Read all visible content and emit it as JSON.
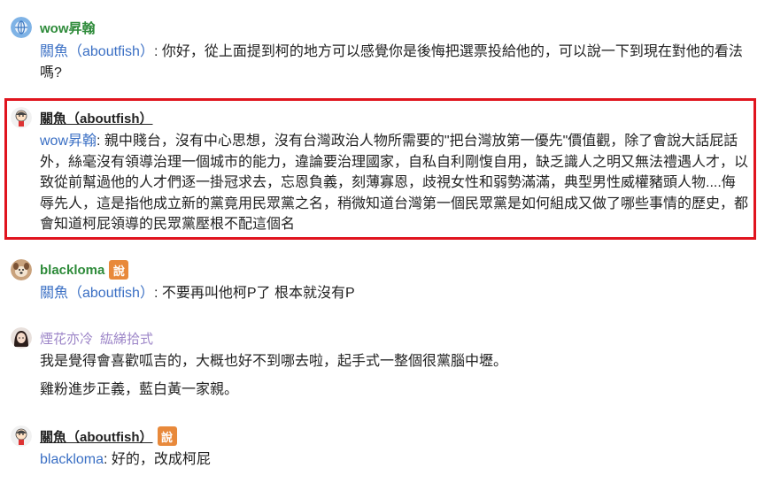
{
  "comments": [
    {
      "author": "wow昇翰",
      "reply_to": "關魚（aboutfish）",
      "sep": ": ",
      "text": "你好，從上面提到柯的地方可以感覺你是後悔把選票投給他的，可以說一下到現在對他的看法嗎?"
    },
    {
      "author": "關魚（aboutfish）",
      "reply_to": "wow昇翰",
      "sep": ": ",
      "text": "親中賤台，沒有中心思想，沒有台灣政治人物所需要的\"把台灣放第一優先\"價值觀，除了會說大話屁話外，絲毫沒有領導治理一個城市的能力，違論要治理國家，自私自利剛愎自用，缺乏識人之明又無法禮遇人才，以致從前幫過他的人才們逐一掛冠求去，忘恩負義，刻薄寡恩，歧視女性和弱勢滿滿，典型男性威權豬頭人物....侮辱先人，這是指他成立新的黨竟用民眾黨之名，稍微知道台灣第一個民眾黨是如何組成又做了哪些事情的歷史，都會知道柯屁領導的民眾黨壓根不配這個名"
    },
    {
      "author": "blackloma",
      "badge": "說",
      "reply_to": "關魚（aboutfish）",
      "sep": ": ",
      "text": "不要再叫他柯P了 根本就沒有P"
    },
    {
      "author": "煙花亦冷",
      "subtitle": "紘綈拾式",
      "paragraphs": [
        "我是覺得會喜歡呱吉的，大概也好不到哪去啦，起手式一整個很黨腦中壢。",
        "雞粉進步正義，藍白黃一家親。"
      ]
    },
    {
      "author": "關魚（aboutfish）",
      "badge": "說",
      "reply_to": "blackloma",
      "sep": ": ",
      "text": "好的，改成柯屁"
    }
  ],
  "colors": {
    "highlight_border": "#e0141e",
    "author_green": "#2e8b3a",
    "reply_blue": "#3a6fc4",
    "badge_orange": "#e8893b",
    "author_lavender": "#9d86c8"
  },
  "icons": {
    "avatar_1": "globe-avatar-icon",
    "avatar_2": "cartoon-avatar-icon",
    "avatar_3": "dog-avatar-icon",
    "avatar_4": "girl-avatar-icon",
    "avatar_5": "cartoon-avatar-icon"
  }
}
